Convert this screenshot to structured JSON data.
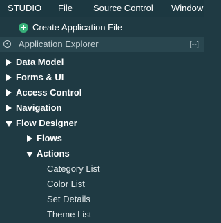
{
  "menu": {
    "items": [
      {
        "label": "STUDIO"
      },
      {
        "label": "File"
      },
      {
        "label": "Source Control"
      },
      {
        "label": "Window"
      }
    ]
  },
  "create": {
    "label": "Create Application File",
    "icon": "plus-circle-icon"
  },
  "explorer": {
    "title": "Application Explorer",
    "more": "[--]"
  },
  "tree": [
    {
      "label": "Data Model",
      "expanded": false
    },
    {
      "label": "Forms & UI",
      "expanded": false
    },
    {
      "label": "Access Control",
      "expanded": false
    },
    {
      "label": "Navigation",
      "expanded": false
    },
    {
      "label": "Flow Designer",
      "expanded": true
    },
    {
      "label": "Flows",
      "expanded": false
    },
    {
      "label": "Actions",
      "expanded": true
    },
    {
      "label": "Category List"
    },
    {
      "label": "Color List"
    },
    {
      "label": "Set Details"
    },
    {
      "label": "Theme List"
    }
  ],
  "colors": {
    "background": "#1f3a43",
    "header": "#29464f",
    "accent": "#38b07a"
  }
}
